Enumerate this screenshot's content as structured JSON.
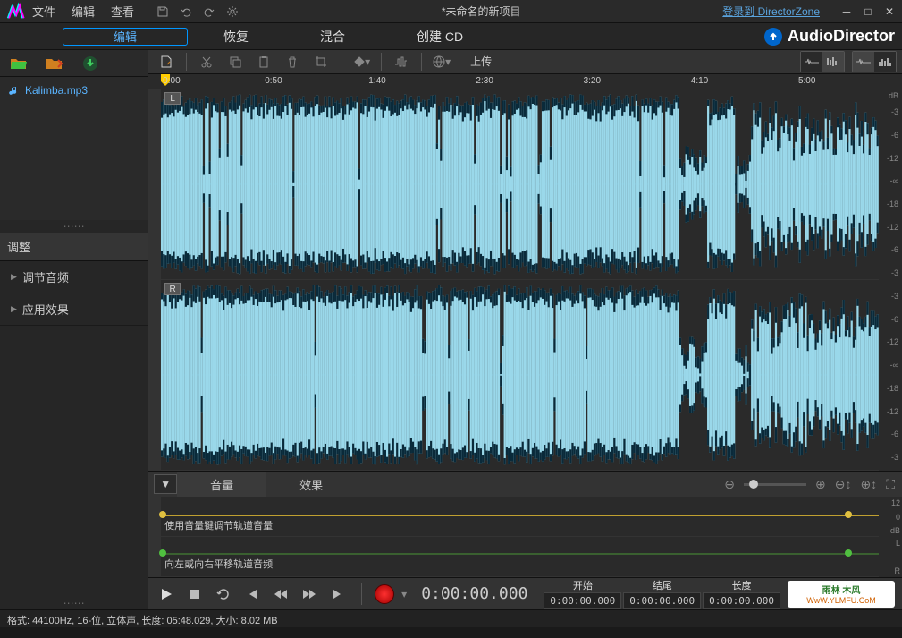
{
  "menu": {
    "file": "文件",
    "edit": "编辑",
    "view": "查看"
  },
  "title": "*未命名的新项目",
  "login_link": "登录到  DirectorZone",
  "edit_button": "编辑",
  "modes": {
    "restore": "恢复",
    "mix": "混合",
    "cd": "创建 CD"
  },
  "brand": "AudioDirector",
  "files": {
    "item0": "Kalimba.mp3"
  },
  "panel": {
    "adjust": "调整",
    "tune": "调节音频",
    "fx": "应用效果"
  },
  "upload": "上传",
  "ruler": {
    "t0": "0:00",
    "t1": "0:50",
    "t2": "1:40",
    "t3": "2:30",
    "t4": "3:20",
    "t5": "4:10",
    "t6": "5:00"
  },
  "channel": {
    "left": "L",
    "right": "R"
  },
  "db": {
    "hdr": "dB",
    "m3": "-3",
    "m6": "-6",
    "m12": "-12",
    "inf": "-∞",
    "m18": "-18"
  },
  "strip": {
    "volume": "音量",
    "fx": "效果"
  },
  "env": {
    "vol": "使用音量键调节轨道音量",
    "pan": "向左或向右平移轨道音频",
    "s12": "12",
    "s0": "0",
    "sdb": "dB",
    "sl": "L",
    "sr": "R"
  },
  "transport": {
    "time": "0:00:00.000",
    "start_lbl": "开始",
    "start_val": "0:00:00.000",
    "end_lbl": "结尾",
    "end_val": "0:00:00.000",
    "len_lbl": "长度",
    "len_val": "0:00:00.000"
  },
  "watermark": {
    "line1": "雨林 木风",
    "line2": "WwW.YLMFU.CoM"
  },
  "status": "格式: 44100Hz, 16-位, 立体声, 长度: 05:48.029, 大小: 8.02 MB"
}
